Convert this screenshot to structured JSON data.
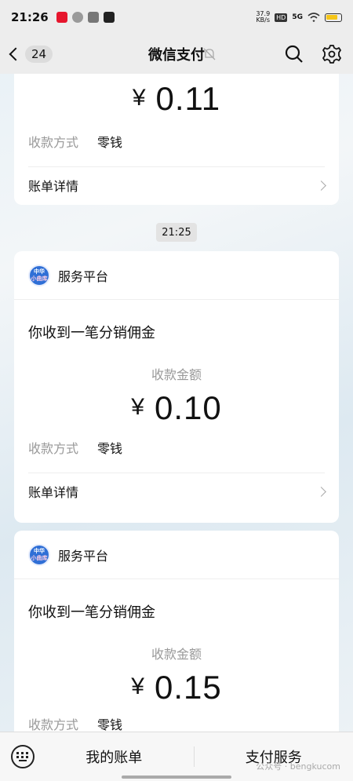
{
  "status_bar": {
    "time": "21:26",
    "net_speed_value": "37.9",
    "net_speed_unit": "KB/s",
    "hd_label": "HD",
    "signal_label": "5G",
    "app_icons": [
      "weibo-icon",
      "wechat-icon",
      "alipay-icon",
      "video-app-icon"
    ]
  },
  "nav": {
    "unread_count": "24",
    "title": "微信支付"
  },
  "cards": [
    {
      "amount_currency": "¥",
      "amount": "0.11",
      "method_key": "收款方式",
      "method_value": "零钱",
      "detail_label": "账单详情"
    },
    {
      "sender": "服务平台",
      "avatar_line1": "中华",
      "avatar_line2": "小曲库",
      "message_title": "你收到一笔分销佣金",
      "amount_label": "收款金额",
      "amount_currency": "¥",
      "amount": "0.10",
      "method_key": "收款方式",
      "method_value": "零钱",
      "detail_label": "账单详情"
    },
    {
      "sender": "服务平台",
      "avatar_line1": "中华",
      "avatar_line2": "小曲库",
      "message_title": "你收到一笔分销佣金",
      "amount_label": "收款金额",
      "amount_currency": "¥",
      "amount": "0.15",
      "method_key": "收款方式",
      "method_value": "零钱"
    }
  ],
  "timestamp": "21:25",
  "bottom_bar": {
    "my_bills": "我的账单",
    "pay_services": "支付服务"
  },
  "watermark": "公众号 · bengkucom",
  "colors": {
    "bar_bg": "#ededed",
    "card_bg": "#ffffff",
    "muted_text": "#999999",
    "avatar_bg": "#2f6fd6"
  }
}
